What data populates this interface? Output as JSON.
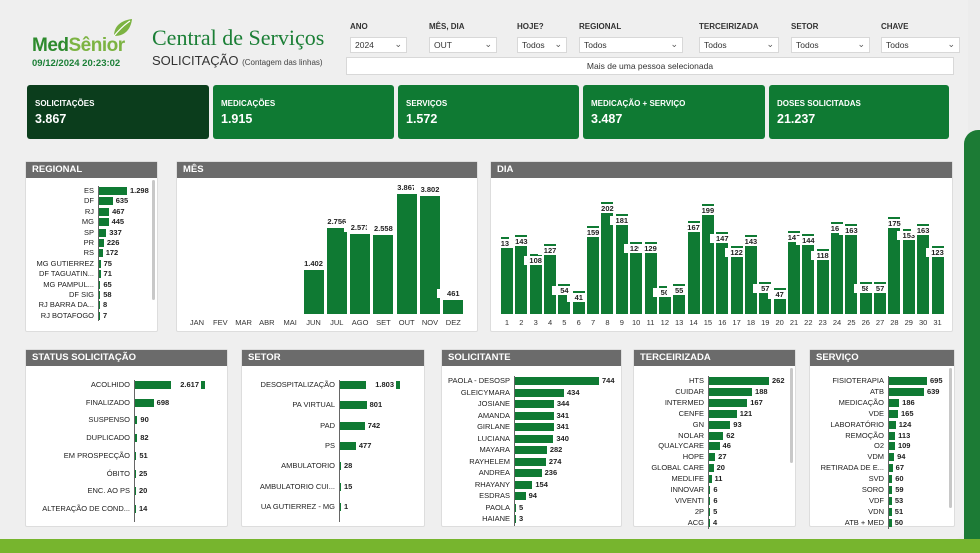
{
  "header": {
    "logo_med": "Med",
    "logo_senior": "Sênior",
    "datetime": "09/12/2024 20:23:02",
    "title": "Central de Serviços",
    "subtitle": "SOLICITAÇÃO",
    "subtitle_note": "(Contagem das linhas)"
  },
  "filters": [
    {
      "label": "ANO",
      "value": "2024"
    },
    {
      "label": "MÊS, DIA",
      "value": "OUT"
    },
    {
      "label": "HOJE?",
      "value": "Todos"
    },
    {
      "label": "REGIONAL",
      "value": "Todos"
    },
    {
      "label": "TERCEIRIZADA",
      "value": "Todos"
    },
    {
      "label": "SETOR",
      "value": "Todos"
    },
    {
      "label": "CHAVE",
      "value": "Todos"
    }
  ],
  "multi_select_text": "Mais de uma pessoa selecionada",
  "kpis": [
    {
      "label": "SOLICITAÇÕES",
      "value": "3.867"
    },
    {
      "label": "MEDICAÇÕES",
      "value": "1.915"
    },
    {
      "label": "SERVIÇOS",
      "value": "1.572"
    },
    {
      "label": "MEDICAÇÃO + SERVIÇO",
      "value": "3.487"
    },
    {
      "label": "DOSES SOLICITADAS",
      "value": "21.237"
    }
  ],
  "panels": {
    "regional": "REGIONAL",
    "mes": "MÊS",
    "dia": "DIA",
    "status": "STATUS SOLICITAÇÃO",
    "setor": "SETOR",
    "solicitante": "SOLICITANTE",
    "terceirizada": "TERCEIRIZADA",
    "servico": "SERVIÇO"
  },
  "colors": {
    "accent": "#0f7a33",
    "dark": "#0b3d1c",
    "header_bar": "#6b6b6b",
    "lime": "#77b52e"
  },
  "chart_data": [
    {
      "id": "regional",
      "type": "bar",
      "orientation": "horizontal",
      "categories": [
        "ES",
        "DF",
        "RJ",
        "MG",
        "SP",
        "PR",
        "RS",
        "MG GUTIERREZ",
        "DF TAGUATIN...",
        "MG PAMPUL...",
        "DF SIG",
        "RJ BARRA DA...",
        "RJ BOTAFOGO"
      ],
      "values": [
        1298,
        635,
        467,
        445,
        337,
        226,
        172,
        75,
        71,
        65,
        58,
        8,
        7
      ],
      "labels": [
        "1.298",
        "635",
        "467",
        "445",
        "337",
        "226",
        "172",
        "75",
        "71",
        "65",
        "58",
        "8",
        "7"
      ]
    },
    {
      "id": "mes",
      "type": "bar",
      "categories": [
        "JAN",
        "FEV",
        "MAR",
        "ABR",
        "MAI",
        "JUN",
        "JUL",
        "AGO",
        "SET",
        "OUT",
        "NOV",
        "DEZ"
      ],
      "values": [
        0,
        0,
        0,
        0,
        0,
        1402,
        2756,
        2573,
        2558,
        3867,
        3802,
        461
      ],
      "labels": [
        "",
        "",
        "",
        "",
        "",
        "1.402",
        "2.756",
        "2.573",
        "2.558",
        "3.867",
        "3.802",
        "461"
      ]
    },
    {
      "id": "dia",
      "type": "bar",
      "categories": [
        "1",
        "2",
        "3",
        "4",
        "5",
        "6",
        "7",
        "8",
        "9",
        "10",
        "11",
        "12",
        "13",
        "14",
        "15",
        "16",
        "17",
        "18",
        "19",
        "20",
        "21",
        "22",
        "23",
        "24",
        "25",
        "26",
        "27",
        "28",
        "29",
        "30",
        "31"
      ],
      "values": [
        138,
        143,
        108,
        127,
        54,
        41,
        159,
        202,
        181,
        129,
        129,
        50,
        55,
        167,
        199,
        147,
        122,
        143,
        57,
        47,
        149,
        144,
        118,
        166,
        163,
        58,
        57,
        175,
        153,
        163,
        123
      ],
      "labels": [
        "138",
        "143",
        "108",
        "127",
        "54",
        "41",
        "159",
        "202",
        "181",
        "129",
        "129",
        "50",
        "55",
        "167",
        "199",
        "147",
        "122",
        "143",
        "57",
        "47",
        "149",
        "144",
        "118",
        "166",
        "163",
        "58",
        "57",
        "175",
        "153",
        "163",
        "123"
      ]
    },
    {
      "id": "status",
      "type": "bar",
      "orientation": "horizontal",
      "categories": [
        "ACOLHIDO",
        "FINALIZADO",
        "SUSPENSO",
        "DUPLICADO",
        "EM PROSPECÇÃO",
        "ÓBITO",
        "ENC. AO PS",
        "ALTERAÇÃO DE COND..."
      ],
      "values": [
        2617,
        698,
        90,
        82,
        51,
        25,
        20,
        14
      ],
      "labels": [
        "2.617",
        "698",
        "90",
        "82",
        "51",
        "25",
        "20",
        "14"
      ]
    },
    {
      "id": "setor",
      "type": "bar",
      "orientation": "horizontal",
      "categories": [
        "DESOSPITALIZAÇÃO",
        "PA VIRTUAL",
        "PAD",
        "PS",
        "AMBULATORIO",
        "AMBULATORIO CUI...",
        "UA GUTIERREZ - MG"
      ],
      "values": [
        1803,
        801,
        742,
        477,
        28,
        15,
        1
      ],
      "labels": [
        "1.803",
        "801",
        "742",
        "477",
        "28",
        "15",
        "1"
      ]
    },
    {
      "id": "solicitante",
      "type": "bar",
      "orientation": "horizontal",
      "categories": [
        "PAOLA - DESOSP",
        "GLEICYMARA",
        "JOSIANE",
        "AMANDA",
        "GIRLANE",
        "LUCIANA",
        "MAYARA",
        "RAYHELEM",
        "ANDREA",
        "RHAYANY",
        "ESDRAS",
        "PAOLA",
        "HAIANE"
      ],
      "values": [
        744,
        434,
        344,
        341,
        341,
        340,
        282,
        274,
        236,
        154,
        94,
        5,
        3
      ],
      "labels": [
        "744",
        "434",
        "344",
        "341",
        "341",
        "340",
        "282",
        "274",
        "236",
        "154",
        "94",
        "5",
        "3"
      ]
    },
    {
      "id": "terceirizada",
      "type": "bar",
      "orientation": "horizontal",
      "categories": [
        "HTS",
        "CUIDAR",
        "INTERMED",
        "CENFE",
        "GN",
        "NOLAR",
        "QUALYCARE",
        "HOPE",
        "GLOBAL CARE",
        "MEDLIFE",
        "INNOVAR",
        "VIVENTI",
        "2P",
        "ACG"
      ],
      "values": [
        262,
        188,
        167,
        121,
        93,
        62,
        46,
        27,
        20,
        11,
        6,
        6,
        5,
        4
      ],
      "labels": [
        "262",
        "188",
        "167",
        "121",
        "93",
        "62",
        "46",
        "27",
        "20",
        "11",
        "6",
        "6",
        "5",
        "4"
      ]
    },
    {
      "id": "servico",
      "type": "bar",
      "orientation": "horizontal",
      "categories": [
        "FISIOTERAPIA",
        "ATB",
        "MEDICAÇÃO",
        "VDE",
        "LABORATÓRIO",
        "REMOÇÃO",
        "O2",
        "VDM",
        "RETIRADA DE E...",
        "SVD",
        "SORO",
        "VDF",
        "VDN",
        "ATB + MED"
      ],
      "values": [
        695,
        639,
        186,
        165,
        124,
        113,
        109,
        94,
        67,
        60,
        59,
        53,
        51,
        50
      ],
      "labels": [
        "695",
        "639",
        "186",
        "165",
        "124",
        "113",
        "109",
        "94",
        "67",
        "60",
        "59",
        "53",
        "51",
        "50"
      ]
    }
  ]
}
